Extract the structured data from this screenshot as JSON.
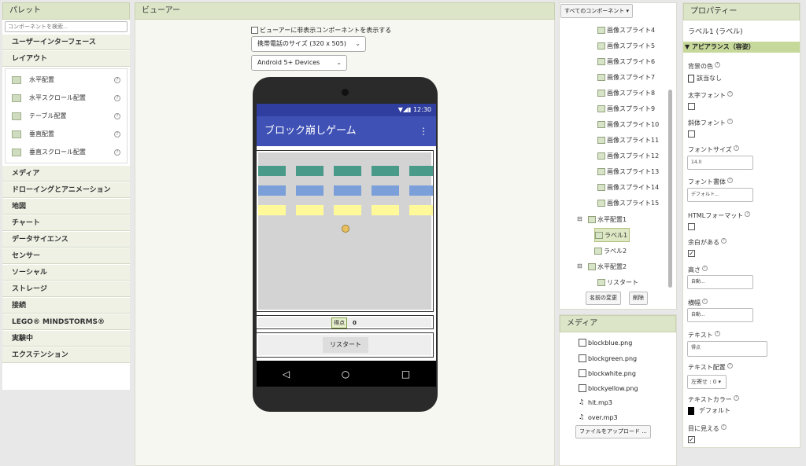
{
  "palette": {
    "title": "パレット",
    "search_placeholder": "コンポーネントを検索...",
    "cat_ui": "ユーザーインターフェース",
    "cat_layout": "レイアウト",
    "layout_items": [
      "水平配置",
      "水平スクロール配置",
      "テーブル配置",
      "垂直配置",
      "垂直スクロール配置"
    ],
    "help": "?",
    "cats_after": [
      "メディア",
      "ドローイングとアニメーション",
      "地図",
      "チャート",
      "データサイエンス",
      "センサー",
      "ソーシャル",
      "ストレージ",
      "接続",
      "LEGO® MINDSTORMS®",
      "実験中",
      "エクステンション"
    ]
  },
  "viewer": {
    "title": "ビューアー",
    "show_hidden": "ビューアーに非表示コンポーネントを表示する",
    "size_select": "携帯電話のサイズ (320 x 505)",
    "android_select": "Android 5+ Devices",
    "time": "12:30",
    "app_title": "ブロック崩しゲーム",
    "menu": "⋮",
    "score_label": "得点",
    "score_value": "0",
    "restart": "リスタート",
    "nav_back": "◁",
    "nav_home": "○",
    "nav_recent": "□"
  },
  "components": {
    "dropdown": "すべてのコンポーネント ▾",
    "sprites": [
      "画像スプライト4",
      "画像スプライト5",
      "画像スプライト6",
      "画像スプライト7",
      "画像スプライト8",
      "画像スプライト9",
      "画像スプライト10",
      "画像スプライト11",
      "画像スプライト12",
      "画像スプライト13",
      "画像スプライト14",
      "画像スプライト15"
    ],
    "h1": "水平配置1",
    "label1": "ラベル1",
    "label2": "ラベル2",
    "h2": "水平配置2",
    "restart": "リスタート",
    "collapse": "⊟",
    "rename": "名前の変更",
    "delete": "削除"
  },
  "media": {
    "title": "メディア",
    "files": [
      "blockblue.png",
      "blockgreen.png",
      "blockwhite.png",
      "blockyellow.png",
      "hit.mp3",
      "over.mp3"
    ],
    "upload": "ファイルをアップロード ..."
  },
  "properties": {
    "title": "プロパティー",
    "component": "ラベル1 (ラベル)",
    "section": "▼ アピアランス（容姿）",
    "bgcolor_label": "背景の色",
    "bgcolor_value": "該当なし",
    "bold_label": "太字フォント",
    "italic_label": "斜体フォント",
    "fontsize_label": "フォントサイズ",
    "fontsize_value": "14.0",
    "typeface_label": "フォント書体",
    "typeface_value": "デフォルト...",
    "html_label": "HTMLフォーマット",
    "margin_label": "余白がある",
    "height_label": "高さ",
    "height_value": "自動...",
    "width_label": "横幅",
    "width_value": "自動...",
    "text_label": "テキスト",
    "text_value": "得点",
    "align_label": "テキスト配置",
    "align_value": "左寄せ : 0 ▾",
    "textcolor_label": "テキストカラー",
    "textcolor_value": "デフォルト",
    "visible_label": "目に見える",
    "check": "✓",
    "help": "?"
  },
  "colors": {
    "green_block": "#4a9a8a",
    "blue_block": "#7b9fd8",
    "yellow_block": "#fff99a",
    "appbar": "#3f51b5"
  }
}
